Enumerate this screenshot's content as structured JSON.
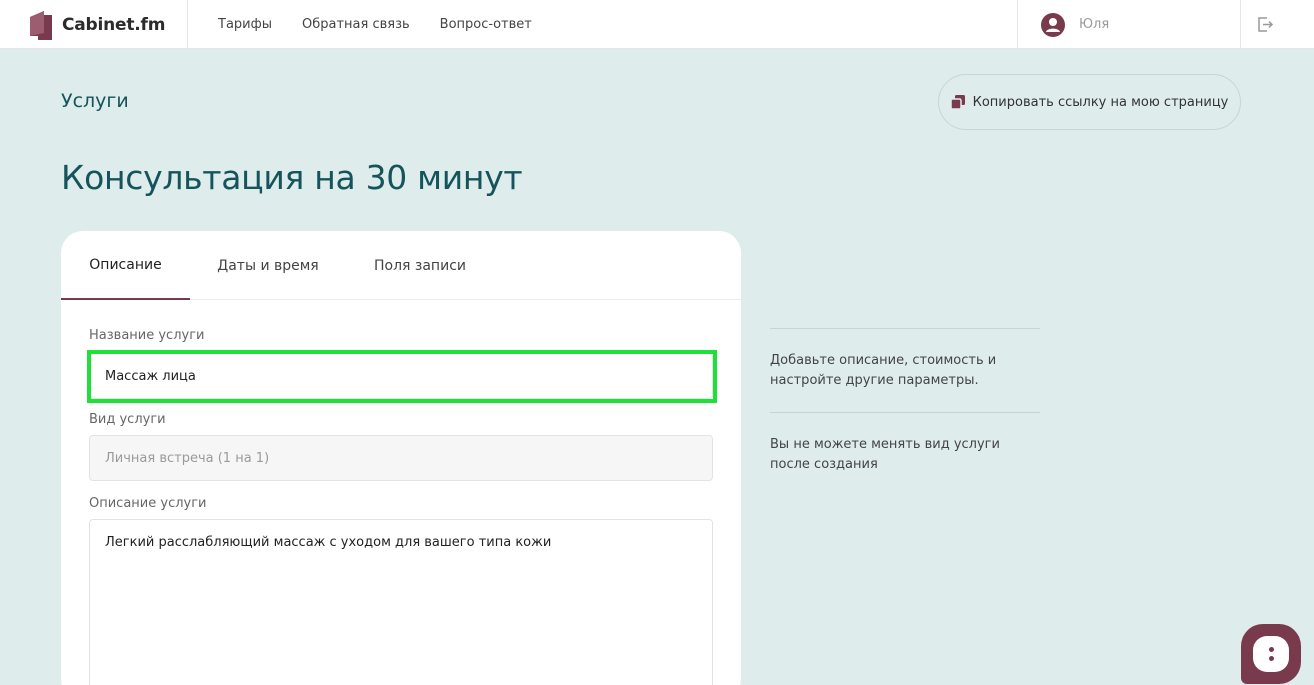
{
  "brand": {
    "name": "Cabinet.fm",
    "accent": "#7a3a4e",
    "title_color": "#14545a",
    "highlight": "#1fe039"
  },
  "nav": [
    "Тарифы",
    "Обратная связь",
    "Вопрос-ответ"
  ],
  "user": {
    "name": "Юля"
  },
  "page": {
    "section": "Услуги",
    "copy_link": "Копировать ссылку на мою страницу",
    "title": "Консультация на 30 минут"
  },
  "tabs": [
    "Описание",
    "Даты и время",
    "Поля записи"
  ],
  "form": {
    "name_label": "Название услуги",
    "name_value": "Массаж лица",
    "type_label": "Вид услуги",
    "type_value": "Личная встреча (1 на 1)",
    "desc_label": "Описание услуги",
    "desc_value": "Легкий расслабляющий массаж с уходом для вашего типа кожи"
  },
  "hints": [
    "Добавьте описание, стоимость и настройте другие параметры.",
    "Вы не можете менять вид услуги после создания"
  ]
}
